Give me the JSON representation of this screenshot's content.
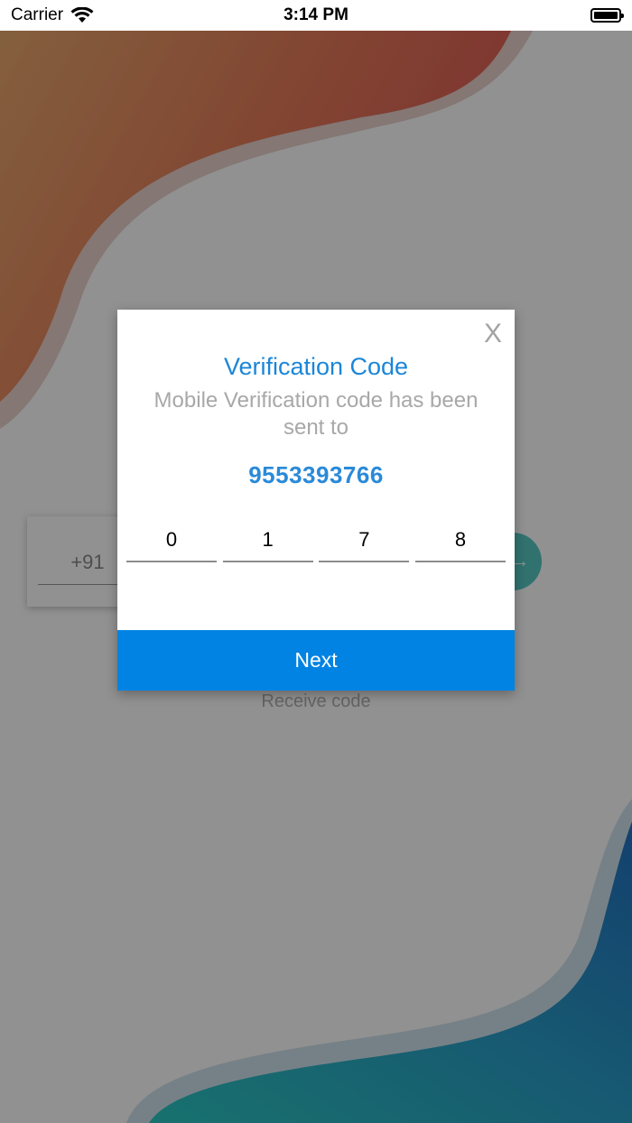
{
  "status_bar": {
    "carrier": "Carrier",
    "time": "3:14 PM"
  },
  "background": {
    "country_code": "+91",
    "go_arrow": "→",
    "receive_code_label": "Receive code",
    "colors": {
      "top_wave": "#d2594a",
      "bottom_wave": "#1f8fc6",
      "accent": "#56c9c4"
    }
  },
  "dialog": {
    "close_label": "X",
    "title": "Verification Code",
    "message": "Mobile Verification code has been sent to",
    "phone_number": "9553393766",
    "otp_digits": [
      "0",
      "1",
      "7",
      "8"
    ],
    "next_label": "Next",
    "colors": {
      "title": "#1b86d8",
      "button": "#0083e2"
    }
  }
}
